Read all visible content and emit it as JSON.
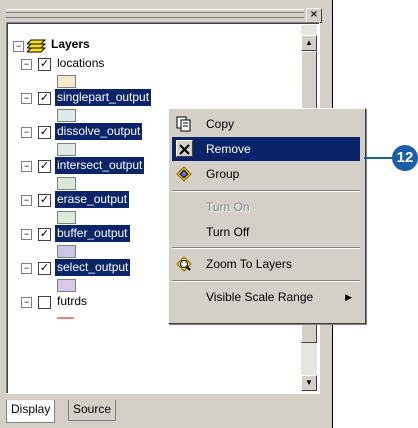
{
  "toc": {
    "root_label": "Layers",
    "close_glyph": "×",
    "layers": [
      {
        "name": "locations",
        "checked": true,
        "selected": false,
        "swatch": "#f5e9c9"
      },
      {
        "name": "singlepart_output",
        "checked": true,
        "selected": true,
        "swatch": "#d9ece9"
      },
      {
        "name": "dissolve_output",
        "checked": true,
        "selected": true,
        "swatch": "#e1ebe6"
      },
      {
        "name": "intersect_output",
        "checked": true,
        "selected": true,
        "swatch": "#d8ead7"
      },
      {
        "name": "erase_output",
        "checked": true,
        "selected": true,
        "swatch": "#d8ecda"
      },
      {
        "name": "buffer_output",
        "checked": true,
        "selected": true,
        "swatch": "#cbc6e6"
      },
      {
        "name": "select_output",
        "checked": true,
        "selected": true,
        "swatch": "#d6cbe9"
      },
      {
        "name": "futrds",
        "checked": false,
        "selected": false,
        "swatch": "#e8857a"
      }
    ],
    "tabs": [
      "Display",
      "Source"
    ]
  },
  "context_menu": {
    "items": [
      {
        "label": "Copy",
        "icon": "copy-icon",
        "enabled": true,
        "highlighted": false
      },
      {
        "label": "Remove",
        "icon": "remove-icon",
        "enabled": true,
        "highlighted": true
      },
      {
        "label": "Group",
        "icon": "group-icon",
        "enabled": true,
        "highlighted": false
      },
      {
        "label": "Turn On",
        "icon": "",
        "enabled": false,
        "highlighted": false
      },
      {
        "label": "Turn Off",
        "icon": "",
        "enabled": true,
        "highlighted": false
      },
      {
        "label": "Zoom To Layers",
        "icon": "zoom-to-layers-icon",
        "enabled": true,
        "highlighted": false
      },
      {
        "label": "Visible Scale Range",
        "icon": "",
        "enabled": true,
        "highlighted": false,
        "submenu": true
      }
    ]
  },
  "callout": {
    "number": "12"
  },
  "colors": {
    "selection": "#0a246a",
    "callout": "#1a5ea8",
    "panel": "#d4d0c8"
  }
}
